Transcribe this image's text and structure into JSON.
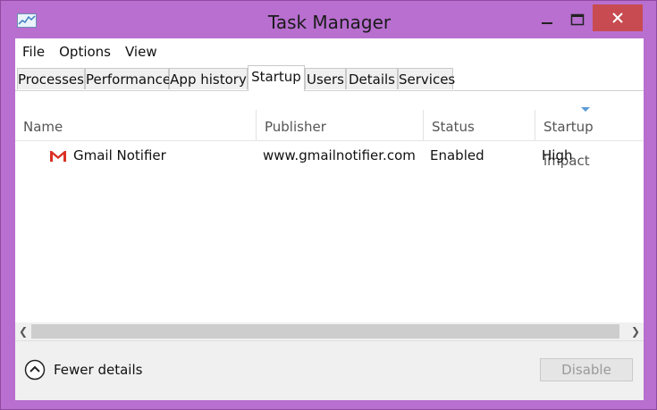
{
  "window": {
    "title": "Task Manager",
    "app_icon": "task-manager-icon",
    "frame_color": "#b86fcf",
    "close_color": "#c74b50"
  },
  "menu": [
    "File",
    "Options",
    "View"
  ],
  "tabs": [
    {
      "label": "Processes",
      "active": false
    },
    {
      "label": "Performance",
      "active": false
    },
    {
      "label": "App history",
      "active": false
    },
    {
      "label": "Startup",
      "active": true
    },
    {
      "label": "Users",
      "active": false
    },
    {
      "label": "Details",
      "active": false
    },
    {
      "label": "Services",
      "active": false
    }
  ],
  "table": {
    "columns": [
      "Name",
      "Publisher",
      "Status",
      "Startup impact"
    ],
    "sorted_column": "Startup impact",
    "rows": [
      {
        "icon": "gmail-icon",
        "name": "Gmail Notifier",
        "publisher": "www.gmailnotifier.com",
        "status": "Enabled",
        "impact": "High"
      }
    ]
  },
  "footer": {
    "fewer_details": "Fewer details",
    "disable_button": "Disable"
  }
}
